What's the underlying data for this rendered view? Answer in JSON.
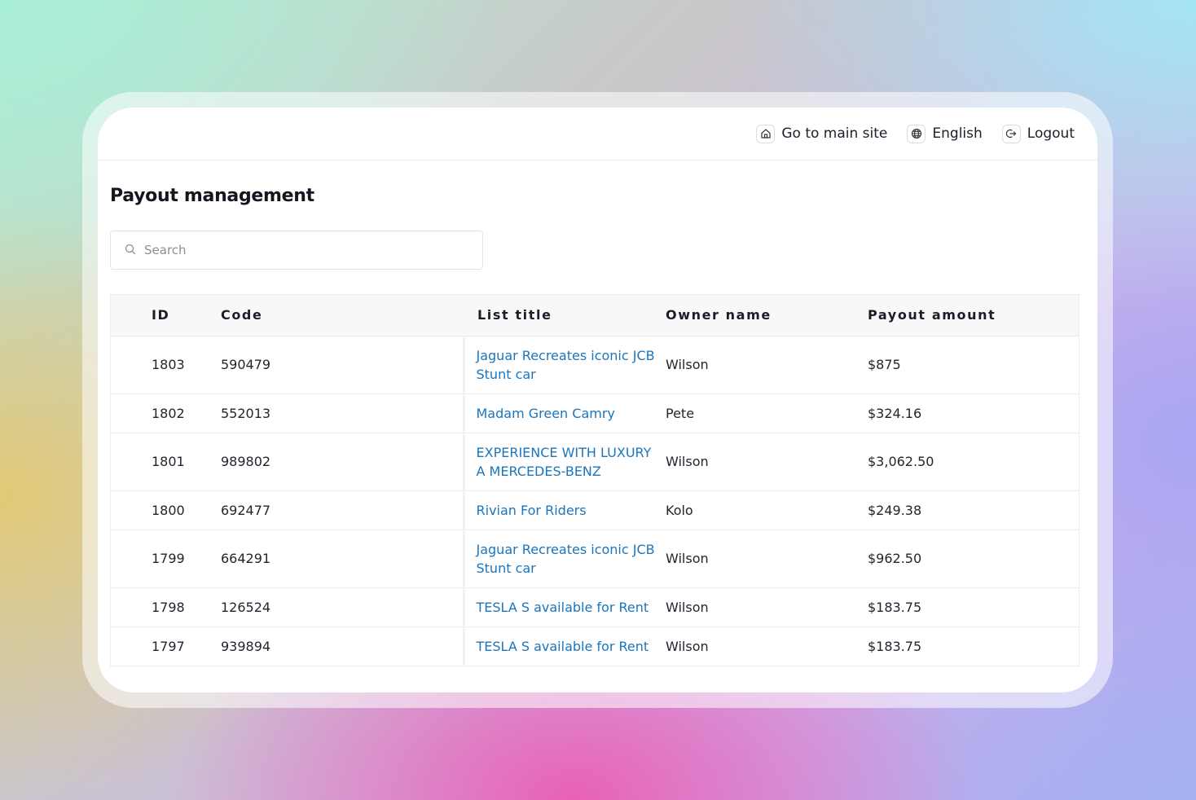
{
  "topbar": {
    "main_site": {
      "label": "Go to main site",
      "icon": "home-icon"
    },
    "language": {
      "label": "English",
      "icon": "globe-icon"
    },
    "logout": {
      "label": "Logout",
      "icon": "logout-icon"
    }
  },
  "page": {
    "title": "Payout management",
    "search_placeholder": "Search",
    "search_value": ""
  },
  "table": {
    "columns": [
      "ID",
      "Code",
      "List title",
      "Owner name",
      "Payout amount"
    ],
    "rows": [
      {
        "id": "1803",
        "code": "590479",
        "title": "Jaguar Recreates iconic JCB Stunt car",
        "owner": "Wilson",
        "amount": "$875"
      },
      {
        "id": "1802",
        "code": "552013",
        "title": "Madam Green Camry",
        "owner": "Pete",
        "amount": "$324.16"
      },
      {
        "id": "1801",
        "code": "989802",
        "title": "EXPERIENCE WITH LUXURY A MERCEDES-BENZ",
        "owner": "Wilson",
        "amount": "$3,062.50"
      },
      {
        "id": "1800",
        "code": "692477",
        "title": "Rivian For Riders",
        "owner": "Kolo",
        "amount": "$249.38"
      },
      {
        "id": "1799",
        "code": "664291",
        "title": "Jaguar Recreates iconic JCB Stunt car",
        "owner": "Wilson",
        "amount": "$962.50"
      },
      {
        "id": "1798",
        "code": "126524",
        "title": "TESLA S available for Rent",
        "owner": "Wilson",
        "amount": "$183.75"
      },
      {
        "id": "1797",
        "code": "939894",
        "title": "TESLA S available for Rent",
        "owner": "Wilson",
        "amount": "$183.75"
      }
    ]
  },
  "colors": {
    "link": "#1b75bb",
    "text": "#24242e"
  }
}
